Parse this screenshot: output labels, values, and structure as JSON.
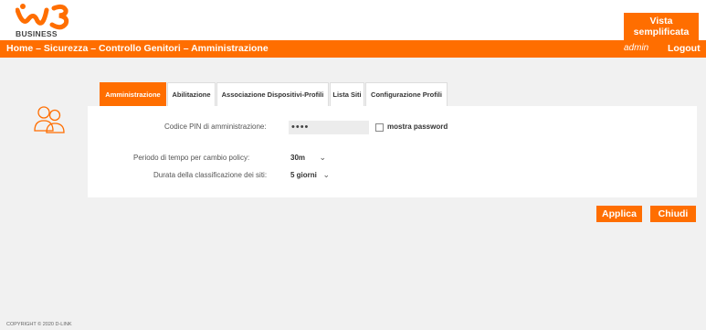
{
  "brand": {
    "logo_text": "BUSINESS",
    "accent": "#ff6e00"
  },
  "header": {
    "simple_view_line1": "Vista",
    "simple_view_line2": "semplificata"
  },
  "nav": {
    "breadcrumb": "Home – Sicurezza – Controllo Genitori – Amministrazione",
    "user": "admin",
    "logout": "Logout"
  },
  "tabs": [
    {
      "label": "Amministrazione",
      "active": true
    },
    {
      "label": "Abilitazione",
      "active": false
    },
    {
      "label": "Associazione Dispositivi-Profili",
      "active": false
    },
    {
      "label": "Lista Siti",
      "active": false
    },
    {
      "label": "Configurazione Profili",
      "active": false
    }
  ],
  "form": {
    "pin_label": "Codice PIN di amministrazione:",
    "pin_value": "••••",
    "show_password_label": "mostra password",
    "policy_label": "Periodo di tempo per cambio policy:",
    "policy_value": "30m",
    "duration_label": "Durata della classificazione dei siti:",
    "duration_value": "5 giorni"
  },
  "actions": {
    "apply": "Applica",
    "close": "Chiudi"
  },
  "footer": {
    "copyright": "COPYRIGHT © 2020 D-LINK"
  }
}
